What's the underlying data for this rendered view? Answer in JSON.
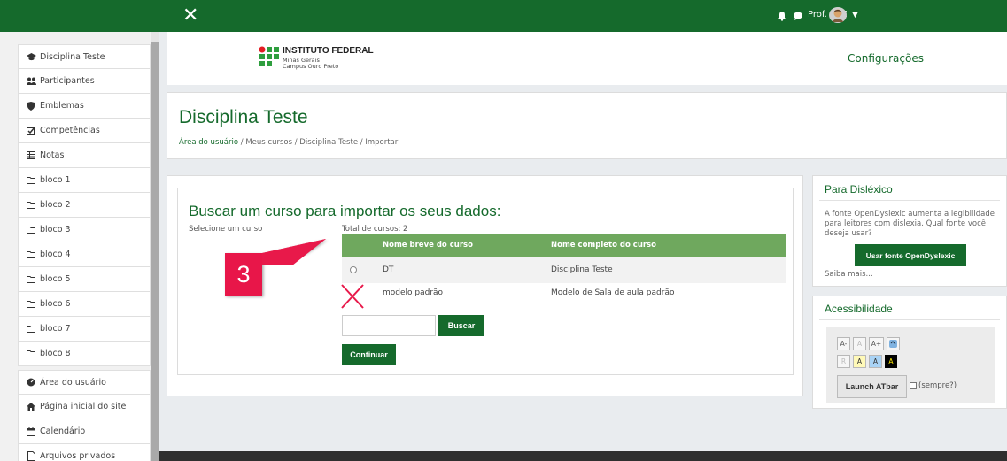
{
  "topbar": {
    "close_symbol": "✕",
    "user_name": "Prof. ERE",
    "icons": [
      "bell-icon",
      "chat-icon",
      "caret-down-icon"
    ]
  },
  "sidebar": {
    "items": [
      {
        "label": "Disciplina Teste",
        "icon": "graduation-cap-icon"
      },
      {
        "label": "Participantes",
        "icon": "users-icon"
      },
      {
        "label": "Emblemas",
        "icon": "shield-icon"
      },
      {
        "label": "Competências",
        "icon": "checkbox-icon"
      },
      {
        "label": "Notas",
        "icon": "table-icon"
      },
      {
        "label": "bloco 1",
        "icon": "folder-icon"
      },
      {
        "label": "bloco 2",
        "icon": "folder-icon"
      },
      {
        "label": "bloco 3",
        "icon": "folder-icon"
      },
      {
        "label": "bloco 4",
        "icon": "folder-icon"
      },
      {
        "label": "bloco 5",
        "icon": "folder-icon"
      },
      {
        "label": "bloco 6",
        "icon": "folder-icon"
      },
      {
        "label": "bloco 7",
        "icon": "folder-icon"
      },
      {
        "label": "bloco 8",
        "icon": "folder-icon"
      }
    ],
    "items2": [
      {
        "label": "Área do usuário",
        "icon": "dashboard-icon"
      },
      {
        "label": "Página inicial do site",
        "icon": "home-icon"
      },
      {
        "label": "Calendário",
        "icon": "calendar-icon"
      },
      {
        "label": "Arquivos privados",
        "icon": "file-icon"
      }
    ]
  },
  "header": {
    "logo_title": "INSTITUTO FEDERAL",
    "logo_sub1": "Minas Gerais",
    "logo_sub2": "Campus Ouro Preto",
    "config_link": "Configurações"
  },
  "page": {
    "title": "Disciplina Teste",
    "breadcrumb": [
      "Área do usuário",
      "Meus cursos",
      "Disciplina Teste",
      "Importar"
    ]
  },
  "import": {
    "heading": "Buscar um curso para importar os seus dados:",
    "select_label": "Selecione um curso",
    "total_label": "Total de cursos: 2",
    "columns": [
      "Nome breve do curso",
      "Nome completo do curso"
    ],
    "rows": [
      {
        "short": "DT",
        "full": "Disciplina Teste"
      },
      {
        "short": "modelo padrão",
        "full": "Modelo de Sala de aula padrão"
      }
    ],
    "search_button": "Buscar",
    "continue_button": "Continuar",
    "search_value": ""
  },
  "annotation": {
    "number": "3",
    "color": "#e8194a"
  },
  "dyslexic": {
    "title": "Para Disléxico",
    "text": "A fonte OpenDyslexic aumenta a legibilidade para leitores com dislexia. Qual fonte você deseja usar?",
    "button": "Usar fonte OpenDyslexic",
    "more": "Saiba mais..."
  },
  "accessibility": {
    "title": "Acessibilidade",
    "buttons_row1": [
      "A-",
      "A",
      "A+"
    ],
    "buttons_row2": [
      "R",
      "A",
      "A",
      "A"
    ],
    "launch": "Launch ATbar",
    "always": "(sempre?)"
  },
  "colors": {
    "brand_green": "#156a2c",
    "table_header_green": "#6fa85e",
    "accent_red": "#e8194a"
  }
}
